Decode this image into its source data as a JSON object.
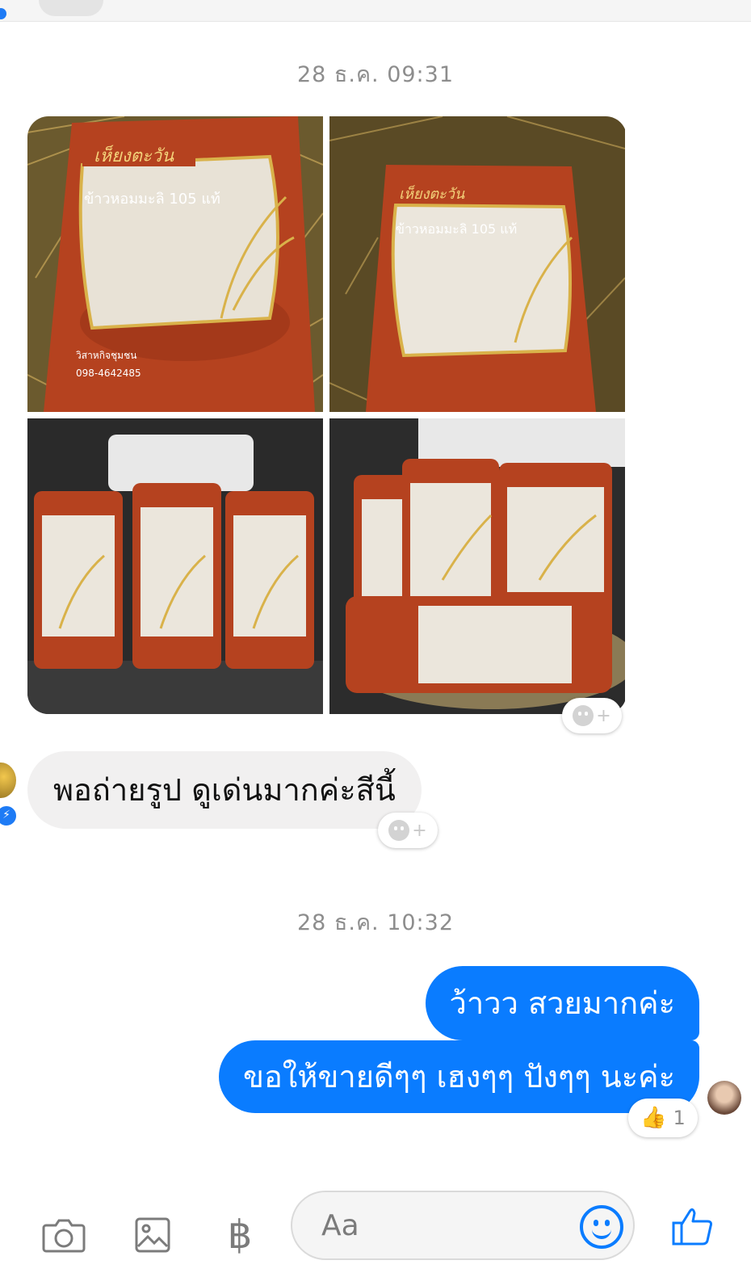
{
  "timestamps": [
    "28 ธ.ค. 09:31",
    "28 ธ.ค. 10:32"
  ],
  "photos": [
    {
      "icon": "rice-bag-photo",
      "brand": "เห็ยงตะวัน",
      "product": "ข้าวหอมมะลิ 105 แท้"
    },
    {
      "icon": "rice-bag-photo",
      "brand": "เห็ยงตะวัน",
      "product": "ข้าวหอมมะลิ 105 แท้"
    },
    {
      "icon": "rice-bags-truck-photo"
    },
    {
      "icon": "rice-bags-truck-photo"
    }
  ],
  "incoming_message": "พอถ่ายรูป  ดูเด่นมากค่ะสีนี้",
  "outgoing_messages": [
    "ว้าวว สวยมากค่ะ",
    "ขอให้ขายดีๆๆ เฮงๆๆ ปังๆๆ นะค่ะ"
  ],
  "reaction": {
    "emoji": "👍",
    "count": "1"
  },
  "react_add": {
    "plus": "+"
  },
  "composer": {
    "placeholder": "Aa",
    "currency_symbol": "฿",
    "icons": [
      "camera-icon",
      "gallery-icon",
      "baht-icon",
      "emoji-icon",
      "like-icon"
    ]
  },
  "colors": {
    "accent": "#0a7cff",
    "incoming_bubble": "#f1f0f0",
    "timestamp": "#8d8d8d"
  }
}
